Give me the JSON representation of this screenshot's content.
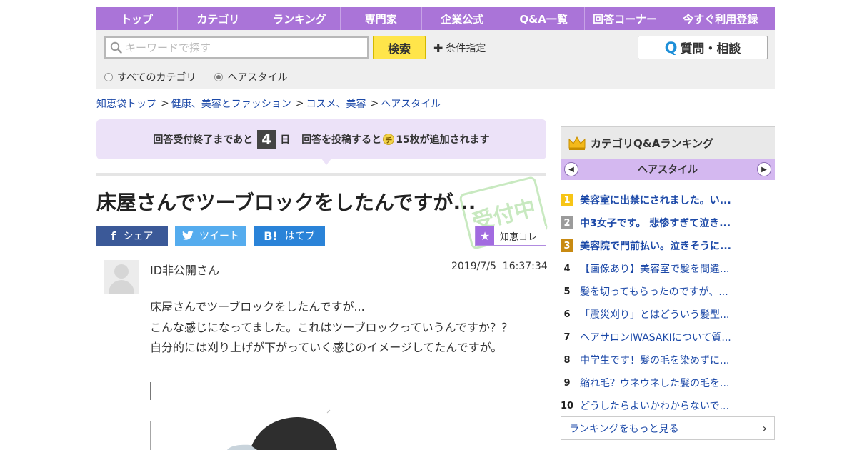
{
  "nav": {
    "items": [
      "トップ",
      "カテゴリ",
      "ランキング",
      "専門家",
      "企業公式",
      "Q&A一覧",
      "回答コーナー",
      "今すぐ利用登録"
    ]
  },
  "search": {
    "placeholder": "キーワードで探す",
    "button": "検索",
    "condition": "条件指定",
    "ask_button": "質問・相談",
    "scope_all": "すべてのカテゴリ",
    "scope_current": "ヘアスタイル",
    "scope_selected": "ヘアスタイル"
  },
  "breadcrumb": {
    "items": [
      "知恵袋トップ",
      "健康、美容とファッション",
      "コスメ、美容",
      "ヘアスタイル"
    ]
  },
  "notice": {
    "before": "回答受付終了まであと",
    "days": "4",
    "after_days": "日",
    "post": "回答を投稿すると",
    "coin_glyph": "チ",
    "coins": "15枚が追加されます"
  },
  "question": {
    "title": "床屋さんでツーブロックをしたんですが...",
    "stamp": "受付中",
    "author": "ID非公開さん",
    "date": "2019/7/5",
    "time": "16:37:34",
    "body": [
      "床屋さんでツーブロックをしたんですが...",
      "こんな感じになってました。これはツーブロックっていうんですか？？",
      "自分的には刈り上げが下がっていく感じのイメージしてたんですが。"
    ]
  },
  "share": {
    "facebook": "シェア",
    "twitter": "ツイート",
    "hatena_icon": "B!",
    "hatena": "はてブ",
    "chiekore": "知恵コレ"
  },
  "ranking": {
    "title": "カテゴリQ&Aランキング",
    "category": "ヘアスタイル",
    "items": [
      {
        "rank": "1",
        "text": "美容室に出禁にされました。い..."
      },
      {
        "rank": "2",
        "text": "中3女子です。 悲惨すぎて泣き..."
      },
      {
        "rank": "3",
        "text": "美容院で門前払い。泣きそうに..."
      },
      {
        "rank": "4",
        "text": "【画像あり】美容室で髪を間違..."
      },
      {
        "rank": "5",
        "text": "髪を切ってもらったのですが、..."
      },
      {
        "rank": "6",
        "text": "「震災刈り」とはどういう髪型..."
      },
      {
        "rank": "7",
        "text": "ヘアサロンIWASAKIについて質..."
      },
      {
        "rank": "8",
        "text": "中学生です！髪の毛を染めずに..."
      },
      {
        "rank": "9",
        "text": "縮れ毛？ウネウネした髪の毛を..."
      },
      {
        "rank": "10",
        "text": "どうしたらよいかわからないで..."
      }
    ],
    "more": "ランキングをもっと見る"
  },
  "colors": {
    "nav": "#aa74d8",
    "link": "#1c49a8",
    "search_button": "#ffe54a",
    "notice_bg": "#ece2f8"
  }
}
